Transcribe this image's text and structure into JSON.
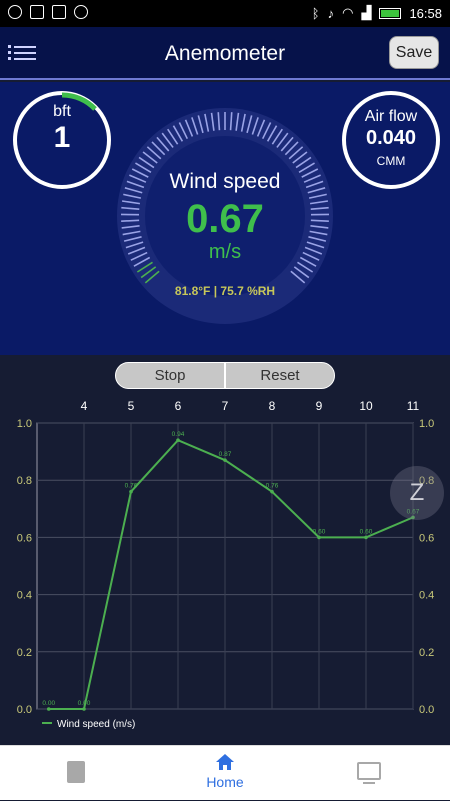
{
  "status": {
    "time": "16:58"
  },
  "header": {
    "title": "Anemometer",
    "save_label": "Save"
  },
  "bft": {
    "label": "bft",
    "value": "1"
  },
  "airflow": {
    "label": "Air flow",
    "value": "0.040",
    "unit": "CMM"
  },
  "gauge": {
    "title": "Wind speed",
    "value": "0.67",
    "unit": "m/s",
    "env": "81.8°F | 75.7 %RH"
  },
  "controls": {
    "stop_label": "Stop",
    "reset_label": "Reset"
  },
  "zoom": {
    "label": "Z"
  },
  "nav": {
    "home_label": "Home"
  },
  "chart_data": {
    "type": "line",
    "x": [
      3,
      4,
      5,
      6,
      7,
      8,
      9,
      10,
      11
    ],
    "x_tick_labels": [
      "4",
      "5",
      "6",
      "7",
      "8",
      "9",
      "10",
      "11"
    ],
    "y_tick_labels": [
      "0.0",
      "0.2",
      "0.4",
      "0.6",
      "0.8",
      "1.0"
    ],
    "ylim": [
      0,
      1.0
    ],
    "series": [
      {
        "name": "Wind speed (m/s)",
        "color": "#4caf50",
        "x": [
          3.25,
          4,
          5,
          6,
          7,
          8,
          9,
          10,
          11
        ],
        "values": [
          0,
          0,
          0.76,
          0.94,
          0.87,
          0.76,
          0.6,
          0.6,
          0.67
        ],
        "labels": [
          "0.00",
          "0.00",
          "0.76",
          "0.94",
          "0.87",
          "0.76",
          "0.60",
          "0.60",
          "0.67"
        ]
      }
    ],
    "legend": "bottom-left",
    "grid": true
  }
}
